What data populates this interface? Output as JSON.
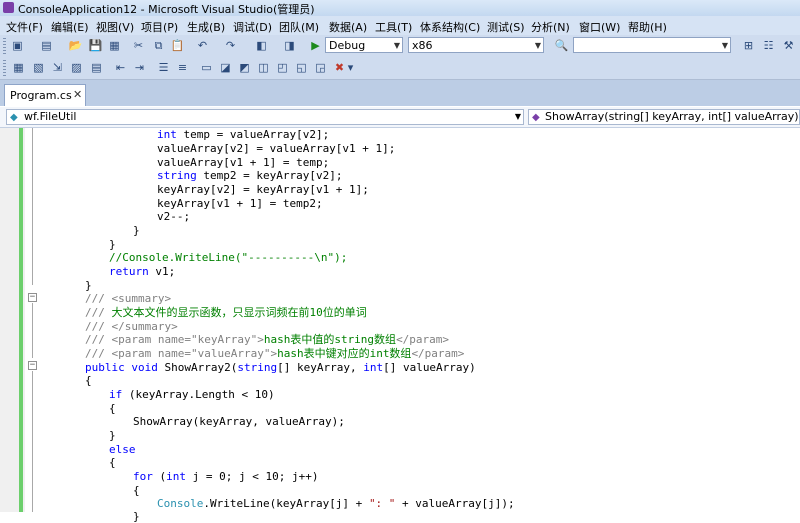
{
  "window": {
    "title": "ConsoleApplication12 - Microsoft Visual Studio(管理员)"
  },
  "menu": [
    "文件(F)",
    "编辑(E)",
    "视图(V)",
    "项目(P)",
    "生成(B)",
    "调试(D)",
    "团队(M)",
    "数据(A)",
    "工具(T)",
    "体系结构(C)",
    "测试(S)",
    "分析(N)",
    "窗口(W)",
    "帮助(H)"
  ],
  "toolbar": {
    "config": "Debug",
    "platform": "x86",
    "find": ""
  },
  "tabs": [
    {
      "label": "Program.cs",
      "close": "✕"
    }
  ],
  "navigation": {
    "type": "wf.FileUtil",
    "member": "ShowArray(string[] keyArray, int[] valueArray)"
  },
  "code": {
    "l1": {
      "kw": "int",
      "rest": " temp = valueArray[v2];"
    },
    "l2": "valueArray[v2] = valueArray[v1 + 1];",
    "l3": "valueArray[v1 + 1] = temp;",
    "l4": {
      "kw": "string",
      "rest": " temp2 = keyArray[v2];"
    },
    "l5": "keyArray[v2] = keyArray[v1 + 1];",
    "l6": "keyArray[v1 + 1] = temp2;",
    "l7": "v2--;",
    "l8": "}",
    "l9": "}",
    "l10": "//Console.WriteLine(\"----------\\n\");",
    "l11": {
      "kw": "return",
      "rest": " v1;"
    },
    "l12": "}",
    "l13": {
      "a": "/// ",
      "b": "<summary>"
    },
    "l14": {
      "a": "/// ",
      "b": "大文本文件的显示函数，只显示词频在前10位的单词"
    },
    "l15": {
      "a": "/// ",
      "b": "</summary>"
    },
    "l16": {
      "a": "/// ",
      "b": "<param name=\"keyArray\">",
      "c": "hash表中值的string数组",
      "d": "</param>"
    },
    "l17": {
      "a": "/// ",
      "b": "<param name=\"valueArray\">",
      "c": "hash表中键对应的int数组",
      "d": "</param>"
    },
    "l18": {
      "k1": "public",
      "k2": "void",
      "m1": " ShowArray2(",
      "k3": "string",
      "m2": "[] keyArray, ",
      "k4": "int",
      "m3": "[] valueArray)"
    },
    "l19": "{",
    "l20": {
      "kw": "if",
      "rest": " (keyArray.Length < 10)"
    },
    "l21": "{",
    "l22": "ShowArray(keyArray, valueArray);",
    "l23": "}",
    "l24": "else",
    "l25": "{",
    "l26": {
      "k1": "for",
      "m1": " (",
      "k2": "int",
      "m2": " j = 0; j < 10; j++)"
    },
    "l27": "{",
    "l28": {
      "ty": "Console",
      "m1": ".WriteLine(keyArray[j] + ",
      "s": "\": \"",
      "m2": " + valueArray[j]);"
    },
    "l29": "}"
  }
}
